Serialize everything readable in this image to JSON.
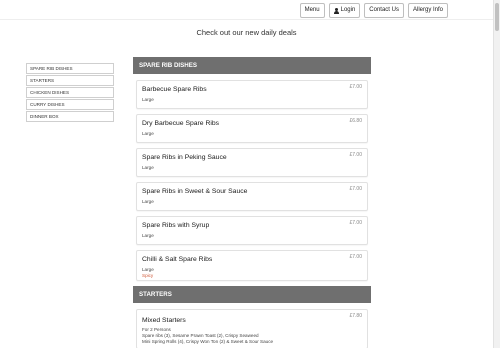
{
  "nav": {
    "menu_label": "Menu",
    "login_label": "Login",
    "contact_label": "Contact Us",
    "allergy_label": "Allergy Info"
  },
  "banner": "Check out our new daily deals",
  "sidebar": {
    "items": [
      {
        "label": "SPARE RIB DISHES"
      },
      {
        "label": "STARTERS"
      },
      {
        "label": "CHICKEN DISHES"
      },
      {
        "label": "CURRY DISHES"
      },
      {
        "label": "DINNER BOX"
      }
    ]
  },
  "sections": [
    {
      "title": "SPARE RIB DISHES",
      "items": [
        {
          "name": "Barbecue Spare Ribs",
          "size": "Large",
          "price": "£7.00"
        },
        {
          "name": "Dry Barbecue Spare Ribs",
          "size": "Large",
          "price": "£6.80"
        },
        {
          "name": "Spare Ribs in Peking Sauce",
          "size": "Large",
          "price": "£7.00"
        },
        {
          "name": "Spare Ribs in Sweet & Sour Sauce",
          "size": "Large",
          "price": "£7.00"
        },
        {
          "name": "Spare Ribs with Syrup",
          "size": "Large",
          "price": "£7.00"
        },
        {
          "name": "Chilli & Salt Spare Ribs",
          "size": "Large",
          "price": "£7.00",
          "tag": "Spicy"
        }
      ]
    },
    {
      "title": "STARTERS",
      "items": [
        {
          "name": "Mixed Starters",
          "price": "£7.80",
          "desc1": "For 2 Persons",
          "desc2": "Spare ribs (3), Sesame Prawn Toast (2), Crispy Seaweed",
          "desc3": "Mini Spring Rolls (4), Crispy Won Ton (2) & Sweet & Sour Sauce"
        }
      ]
    }
  ],
  "icons": {
    "login": "user-icon"
  },
  "colors": {
    "section_header_bg": "#6f6f6f",
    "spicy_tag": "#d05a3a"
  }
}
